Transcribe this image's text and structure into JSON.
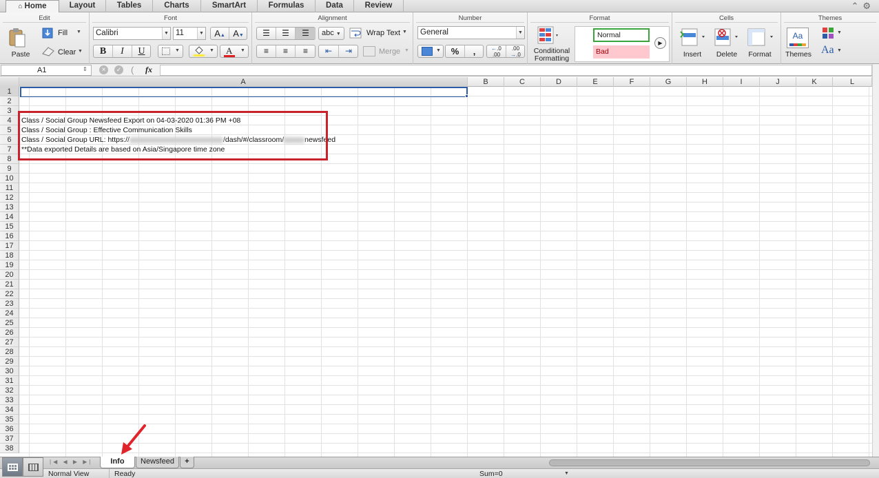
{
  "tabs": [
    {
      "label": "Home",
      "active": true
    },
    {
      "label": "Layout"
    },
    {
      "label": "Tables"
    },
    {
      "label": "Charts"
    },
    {
      "label": "SmartArt"
    },
    {
      "label": "Formulas"
    },
    {
      "label": "Data"
    },
    {
      "label": "Review"
    }
  ],
  "ribbon": {
    "edit": {
      "title": "Edit",
      "paste": "Paste",
      "fill": "Fill",
      "clear": "Clear"
    },
    "font": {
      "title": "Font",
      "name": "Calibri",
      "size": "11",
      "bold": "B",
      "italic": "I",
      "underline": "U"
    },
    "alignment": {
      "title": "Alignment",
      "wrap_text": "Wrap Text",
      "merge": "Merge",
      "abc": "abc"
    },
    "number": {
      "title": "Number",
      "format": "General",
      "percent": "%",
      "comma": ","
    },
    "format": {
      "title": "Format",
      "conditional_line1": "Conditional",
      "conditional_line2": "Formatting",
      "style_normal": "Normal",
      "style_bad": "Bad"
    },
    "cells": {
      "title": "Cells",
      "insert": "Insert",
      "delete": "Delete",
      "format": "Format"
    },
    "themes": {
      "title": "Themes",
      "themes": "Themes",
      "aa": "Aa"
    }
  },
  "formula_bar": {
    "name_box": "A1",
    "fx": "fx",
    "value": ""
  },
  "columns": [
    "A",
    "B",
    "C",
    "D",
    "E",
    "F",
    "G",
    "H",
    "I",
    "J",
    "K",
    "L"
  ],
  "rows": [
    "1",
    "2",
    "3",
    "4",
    "5",
    "6",
    "7",
    "8",
    "9",
    "10",
    "11",
    "12",
    "13",
    "14",
    "15",
    "16",
    "17",
    "18",
    "19",
    "20",
    "21",
    "22",
    "23",
    "24",
    "25",
    "26",
    "27",
    "28",
    "29",
    "30",
    "31",
    "32",
    "33",
    "34",
    "35",
    "36",
    "37",
    "38"
  ],
  "cells": {
    "r4": "Class / Social Group Newsfeed Export on 04-03-2020 01:36 PM +08",
    "r5": "Class / Social Group : Effective Communication Skills",
    "r6_prefix": "Class / Social Group URL: https://",
    "r6_mid": "/dash/#/classroom/",
    "r6_suffix": "newsfeed",
    "r7": "**Data exported Details are based on Asia/Singapore time zone"
  },
  "sheets": [
    {
      "label": "Info",
      "active": true
    },
    {
      "label": "Newsfeed"
    }
  ],
  "add_sheet": "+",
  "status": {
    "view": "Normal View",
    "state": "Ready",
    "sum": "Sum=0"
  },
  "colors": {
    "selection": "#2a5ca8",
    "annotation": "#c8232c",
    "normal_style": "#3aa53a",
    "bad_style": "#ffc7ce"
  }
}
